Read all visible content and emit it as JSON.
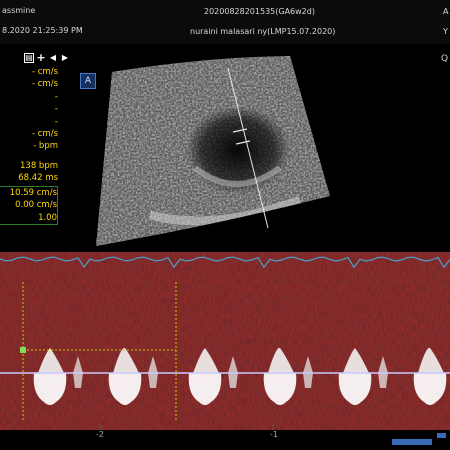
{
  "header": {
    "user_fragment": "assmine",
    "datetime": "8.2020   21:25:39 PM",
    "exam_id": "20200828201535(GA6w2d)",
    "patient": "nuraini malasari ny(LMP15.07.2020)",
    "right_fragment_top": "A",
    "right_fragment_bottom": "Y",
    "right_q": "Q"
  },
  "toolbar_icons": [
    "copy-icon",
    "plus-icon",
    "play-left-icon",
    "play-right-icon"
  ],
  "measurements_top": [
    {
      "value": "- cm/s"
    },
    {
      "value": "- cm/s"
    },
    {
      "value": "-"
    },
    {
      "value": "-"
    },
    {
      "value": "-"
    },
    {
      "value": "- cm/s"
    },
    {
      "value": "- bpm"
    }
  ],
  "measurements_mid": [
    {
      "value": "138 bpm"
    },
    {
      "value": "68.42 ms"
    }
  ],
  "measurements_box": [
    {
      "value": "10.59 cm/s"
    },
    {
      "value": "0.00 cm/s"
    },
    {
      "value": "1.00"
    }
  ],
  "mode_icon_label": "A",
  "time_axis": {
    "labels": [
      "-2",
      "-1"
    ]
  },
  "colors": {
    "measurement_text": "#ffd800",
    "spectral_bg": "#8c2b2b",
    "baseline": "#c9c9ff",
    "caliper": "#d4c600",
    "envelope": "#4aa0c8",
    "mode_icon": "#4a77c8"
  }
}
